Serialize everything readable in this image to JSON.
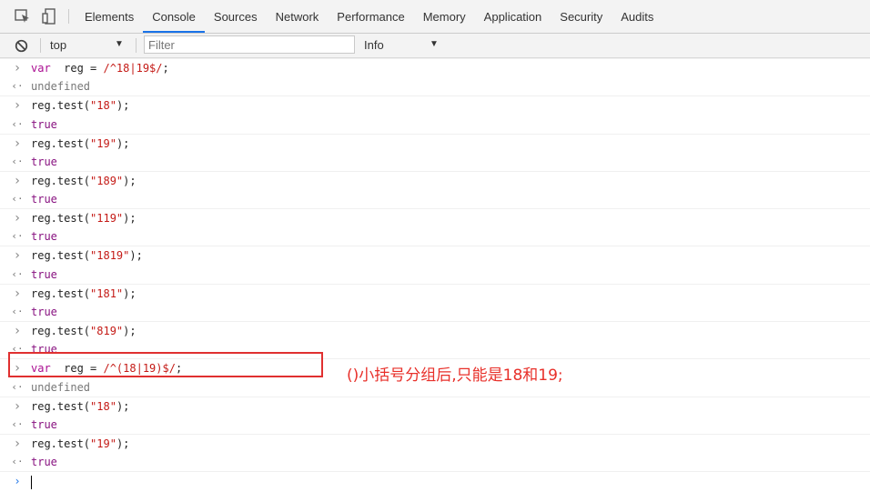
{
  "tabs": [
    {
      "label": "Elements",
      "active": false
    },
    {
      "label": "Console",
      "active": true
    },
    {
      "label": "Sources",
      "active": false
    },
    {
      "label": "Network",
      "active": false
    },
    {
      "label": "Performance",
      "active": false
    },
    {
      "label": "Memory",
      "active": false
    },
    {
      "label": "Application",
      "active": false
    },
    {
      "label": "Security",
      "active": false
    },
    {
      "label": "Audits",
      "active": false
    }
  ],
  "toolbar": {
    "context": "top",
    "filter_placeholder": "Filter",
    "filter_value": "",
    "levels": "Info"
  },
  "log": [
    {
      "type": "in",
      "parts": [
        [
          "kw",
          "var"
        ],
        [
          "",
          "  reg = "
        ],
        [
          "re",
          "/^18|19$/"
        ],
        [
          "",
          ";"
        ]
      ]
    },
    {
      "type": "out",
      "text": "undefined",
      "undef": true
    },
    {
      "type": "in",
      "parts": [
        [
          "",
          "reg.test("
        ],
        [
          "str",
          "\"18\""
        ],
        [
          "",
          ");"
        ]
      ]
    },
    {
      "type": "out",
      "text": "true"
    },
    {
      "type": "in",
      "parts": [
        [
          "",
          "reg.test("
        ],
        [
          "str",
          "\"19\""
        ],
        [
          "",
          ");"
        ]
      ]
    },
    {
      "type": "out",
      "text": "true"
    },
    {
      "type": "in",
      "parts": [
        [
          "",
          "reg.test("
        ],
        [
          "str",
          "\"189\""
        ],
        [
          "",
          ");"
        ]
      ]
    },
    {
      "type": "out",
      "text": "true"
    },
    {
      "type": "in",
      "parts": [
        [
          "",
          "reg.test("
        ],
        [
          "str",
          "\"119\""
        ],
        [
          "",
          ");"
        ]
      ]
    },
    {
      "type": "out",
      "text": "true"
    },
    {
      "type": "in",
      "parts": [
        [
          "",
          "reg.test("
        ],
        [
          "str",
          "\"1819\""
        ],
        [
          "",
          ");"
        ]
      ]
    },
    {
      "type": "out",
      "text": "true"
    },
    {
      "type": "in",
      "parts": [
        [
          "",
          "reg.test("
        ],
        [
          "str",
          "\"181\""
        ],
        [
          "",
          ");"
        ]
      ]
    },
    {
      "type": "out",
      "text": "true"
    },
    {
      "type": "in",
      "parts": [
        [
          "",
          "reg.test("
        ],
        [
          "str",
          "\"819\""
        ],
        [
          "",
          ");"
        ]
      ]
    },
    {
      "type": "out",
      "text": "true"
    },
    {
      "type": "in",
      "parts": [
        [
          "kw",
          "var"
        ],
        [
          "",
          "  reg = "
        ],
        [
          "re",
          "/^(18|19)$/"
        ],
        [
          "",
          ";"
        ]
      ]
    },
    {
      "type": "out",
      "text": "undefined",
      "undef": true
    },
    {
      "type": "in",
      "parts": [
        [
          "",
          "reg.test("
        ],
        [
          "str",
          "\"18\""
        ],
        [
          "",
          ");"
        ]
      ]
    },
    {
      "type": "out",
      "text": "true"
    },
    {
      "type": "in",
      "parts": [
        [
          "",
          "reg.test("
        ],
        [
          "str",
          "\"19\""
        ],
        [
          "",
          ");"
        ]
      ]
    },
    {
      "type": "out",
      "text": "true"
    }
  ],
  "annotation": "()小括号分组后,只能是18和19;",
  "colors": {
    "highlight_box": "#e03030",
    "annotation_text": "#e8302a",
    "active_tab_underline": "#1a73e8"
  }
}
